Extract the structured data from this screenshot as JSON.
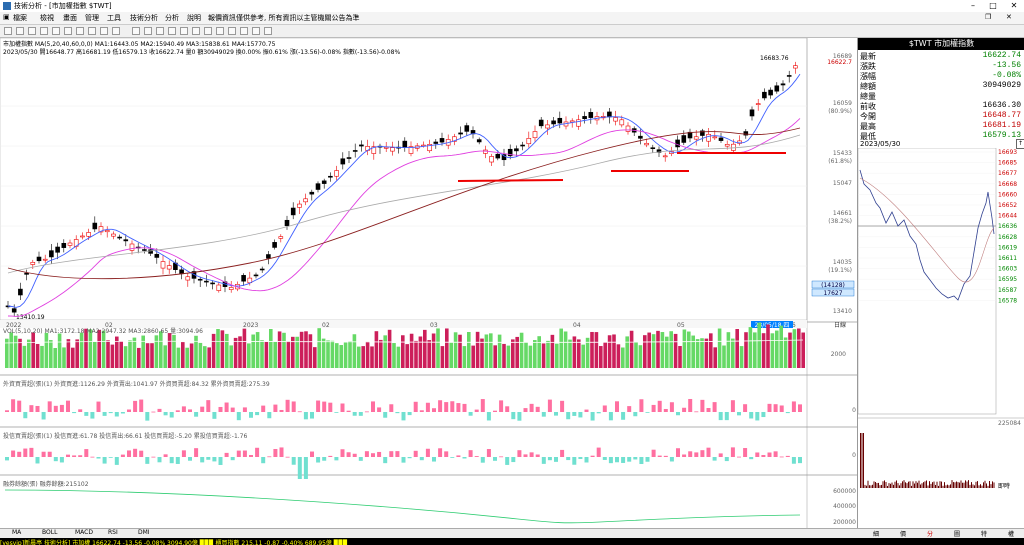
{
  "window": {
    "title": "技術分析 - [市加權指數 $TWT]"
  },
  "menu": [
    "檔案",
    "檢視",
    "畫面",
    "管理",
    "工具",
    "技術分析",
    "分析",
    "說明",
    "報價資訊僅供參考, 所有資訊以主管機關公告為準"
  ],
  "price_panel": {
    "header1": "市加權指數 MA(5,20,40,60,0,0) MA1:16443.05 MA2:15940.49 MA3:15838.61 MA4:15770.75",
    "header2": "2023/05/30 開16648.77 高16681.19 低16579.13 收16622.74 量0 額30949029 換0.00% 振0.61% 漲(-13.56)-0.08% 指數(-13.56)-0.08%",
    "y_labels": [
      "16689",
      "16622.7",
      "16059",
      "(80.9%)",
      "15433",
      "(61.8%)",
      "15047",
      "14661",
      "(38.2%)",
      "14035",
      "(19.1%)",
      "13410"
    ],
    "x_labels": [
      "2022",
      "02",
      "2023",
      "02",
      "03",
      "04",
      "05",
      "06"
    ],
    "annot_high": "16683.76",
    "annot_low": "13410.19",
    "cursor_date": "23/05/18,四",
    "crosshair_box1": "(14128)",
    "crosshair_box2": "17627",
    "unit": "日線"
  },
  "vol_panel": {
    "header": "VOL(5,10,20) MA1:3172.18 MA2:2947.32 MA3:2860.65 量:3094.96",
    "y_label": "2000"
  },
  "foreign_panel": {
    "header": "外資買賣超(張)(1) 外資買進:1126.29 外資賣出:1041.97 外資買賣超:84.32 累外資買賣超:275.39",
    "y_label": "0"
  },
  "invest_panel": {
    "header": "投信買賣超(張)(1) 投信買進:61.78 投信賣出:66.61 投信買賣超:-5.20 累投信買賣超:-1.76",
    "y_label": "0"
  },
  "margin_panel": {
    "header": "融券餘額(張) 融券餘額:215102",
    "y_labels": [
      "600000",
      "400000",
      "200000"
    ]
  },
  "bottom_tabs": [
    "MA",
    "BOLL",
    "MACD",
    "RSI",
    "DMI"
  ],
  "quote": {
    "title": "$TWT 市加權指數",
    "rows": [
      {
        "k": "最新",
        "v": "16622.74",
        "c": "#008000"
      },
      {
        "k": "漲跌",
        "v": "-13.56",
        "c": "#008000"
      },
      {
        "k": "漲幅",
        "v": "-0.08%",
        "c": "#008000"
      },
      {
        "k": "總額",
        "v": "30949029",
        "c": "#000000"
      },
      {
        "k": "總量",
        "v": "",
        "c": "#000000"
      },
      {
        "k": "前收",
        "v": "16636.30",
        "c": "#000000"
      },
      {
        "k": "今開",
        "v": "16648.77",
        "c": "#c00000"
      },
      {
        "k": "最高",
        "v": "16681.19",
        "c": "#c00000"
      },
      {
        "k": "最低",
        "v": "16579.13",
        "c": "#008000"
      }
    ],
    "date": "2023/05/30",
    "intraday_y": [
      "16693",
      "16685",
      "16677",
      "16668",
      "16660",
      "16652",
      "16644",
      "16636",
      "16628",
      "16619",
      "16611",
      "16603",
      "16595",
      "16587",
      "16578"
    ],
    "vol_y": "225084",
    "vol_tag": "即時"
  },
  "right_tabs": [
    "細",
    "價",
    "分",
    "圖",
    "特",
    "權"
  ],
  "ticker": "[yesvip]新晨亭 技術分析]   市加權 16622.74 -13.56 -0.08% 3094.90億   ▉▉▉   櫃買指數 215.11 -0.87 -0.40% 689.95億   ▉▉▉"
}
